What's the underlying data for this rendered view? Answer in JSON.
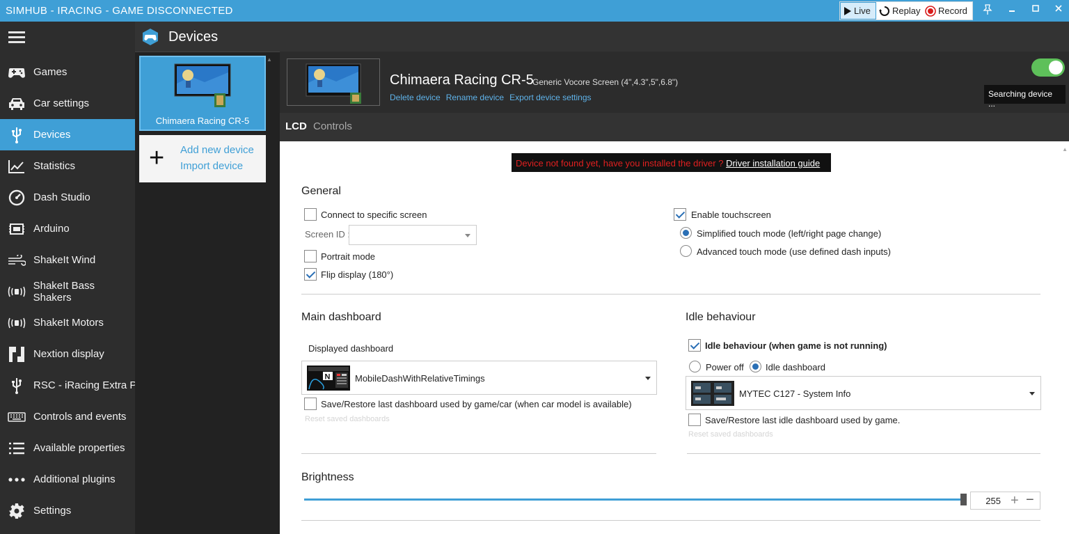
{
  "window": {
    "title": "SIMHUB - IRACING - GAME DISCONNECTED",
    "controls": {
      "live": "Live",
      "replay": "Replay",
      "record": "Record"
    }
  },
  "header": {
    "title": "Devices"
  },
  "sidebar": {
    "items": [
      {
        "label": "Games",
        "icon": "gamepad-icon"
      },
      {
        "label": "Car settings",
        "icon": "car-icon"
      },
      {
        "label": "Devices",
        "icon": "usb-icon",
        "active": true
      },
      {
        "label": "Statistics",
        "icon": "chart-line-icon"
      },
      {
        "label": "Dash Studio",
        "icon": "gauge-icon"
      },
      {
        "label": "Arduino",
        "icon": "chip-icon"
      },
      {
        "label": "ShakeIt Wind",
        "icon": "wind-icon"
      },
      {
        "label": "ShakeIt Bass Shakers",
        "icon": "vibration-icon"
      },
      {
        "label": "ShakeIt Motors",
        "icon": "vibration-icon"
      },
      {
        "label": "Nextion display",
        "icon": "nextion-icon"
      },
      {
        "label": "RSC - iRacing Extra Pro",
        "icon": "usb-icon"
      },
      {
        "label": "Controls and events",
        "icon": "keyboard-icon"
      },
      {
        "label": "Available properties",
        "icon": "list-icon"
      },
      {
        "label": "Additional plugins",
        "icon": "dots-icon"
      },
      {
        "label": "Settings",
        "icon": "gear-icon"
      }
    ]
  },
  "device_list": {
    "selected_device": "Chimaera Racing CR-5",
    "add_new": "Add new device",
    "import": "Import device"
  },
  "device": {
    "name": "Chimaera Racing CR-5",
    "subtitle": "Generic Vocore Screen (4\",4.3\",5\",6.8\")",
    "links": {
      "delete": "Delete device",
      "rename": "Rename device",
      "export": "Export device settings"
    },
    "status": "Searching device ...",
    "enabled": true
  },
  "tabs": {
    "lcd": "LCD",
    "controls": "Controls"
  },
  "error": {
    "message": "Device not found yet, have you installed the driver ?",
    "link": "Driver installation guide"
  },
  "general": {
    "title": "General",
    "connect_specific": {
      "label": "Connect to specific screen",
      "checked": false
    },
    "screen_id_label": "Screen ID :",
    "screen_id_value": "",
    "portrait": {
      "label": "Portrait mode",
      "checked": false
    },
    "flip": {
      "label": "Flip display (180°)",
      "checked": true
    },
    "touchscreen": {
      "label": "Enable touchscreen",
      "checked": true
    },
    "simplified_touch": {
      "label": "Simplified touch mode (left/right page change)",
      "selected": true
    },
    "advanced_touch": {
      "label": "Advanced touch mode (use defined dash inputs)",
      "selected": false
    }
  },
  "main_dashboard": {
    "title": "Main dashboard",
    "displayed_label": "Displayed dashboard",
    "selected": "MobileDashWithRelativeTimings",
    "save_restore": {
      "label": "Save/Restore last dashboard used by game/car (when car model is available)",
      "checked": false
    },
    "reset_link": "Reset saved dashboards"
  },
  "idle": {
    "title": "Idle behaviour",
    "enabled": {
      "label": "Idle behaviour (when game is not running)",
      "checked": true
    },
    "power_off": "Power off",
    "idle_dashboard": "Idle dashboard",
    "mode": "idle_dashboard",
    "selected": "MYTEC C127 - System Info",
    "save_restore": {
      "label": "Save/Restore last idle dashboard used by game.",
      "checked": false
    },
    "reset_link": "Reset saved dashboards"
  },
  "brightness": {
    "title": "Brightness",
    "value": "255",
    "max": 255
  },
  "colors": {
    "accent": "#3f9fd6",
    "sidebar": "#2d2d2d",
    "error": "#e02020",
    "toggle_on": "#5ec05a"
  }
}
